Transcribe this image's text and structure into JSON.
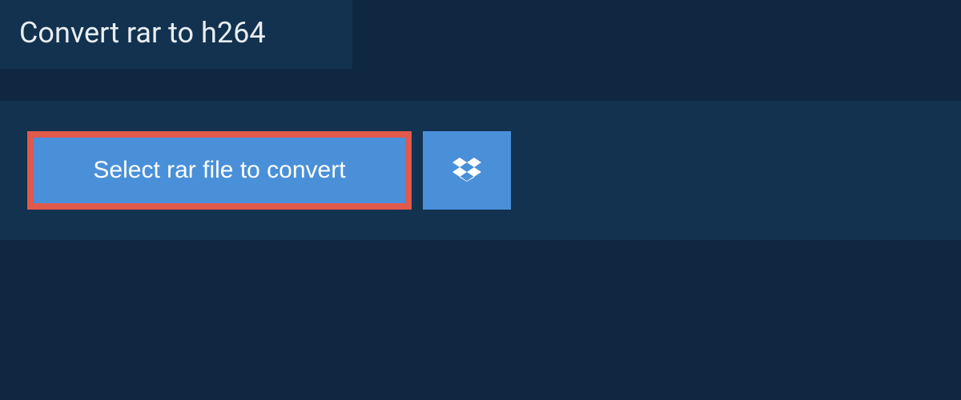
{
  "header": {
    "title": "Convert rar to h264"
  },
  "actions": {
    "select_file_label": "Select rar file to convert",
    "dropbox_icon": "dropbox-icon"
  },
  "colors": {
    "page_bg": "#0f2740",
    "panel_bg": "#12324f",
    "button_bg": "#4a90d9",
    "highlight_border": "#e0594c",
    "text_light": "#e8eef3",
    "text_white": "#ffffff"
  }
}
